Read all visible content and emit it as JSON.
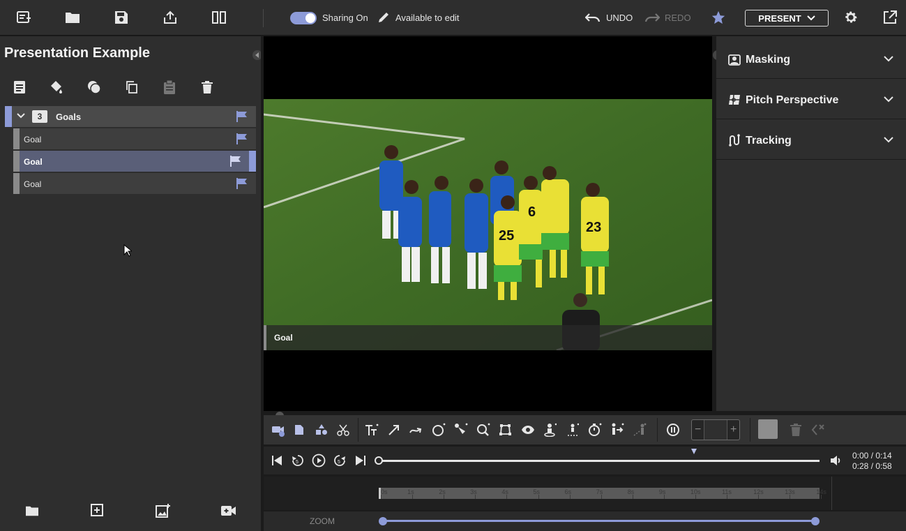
{
  "topbar": {
    "sharing_label": "Sharing On",
    "sharing_on": true,
    "edit_label": "Available to edit",
    "undo_label": "UNDO",
    "redo_label": "REDO",
    "present_label": "PRESENT"
  },
  "left": {
    "title": "Presentation Example",
    "group": {
      "count": "3",
      "label": "Goals"
    },
    "items": [
      {
        "label": "Goal"
      },
      {
        "label": "Goal"
      },
      {
        "label": "Goal"
      }
    ]
  },
  "video": {
    "caption": "Goal"
  },
  "right": {
    "sections": [
      {
        "label": "Masking"
      },
      {
        "label": "Pitch Perspective"
      },
      {
        "label": "Tracking"
      }
    ]
  },
  "playback": {
    "time_current": "0:00 / 0:14",
    "time_total": "0:28 / 0:58"
  },
  "timeline": {
    "ticks": [
      "0s",
      "1s",
      "2s",
      "3s",
      "4s",
      "5s",
      "6s",
      "7s",
      "8s",
      "9s",
      "10s",
      "11s",
      "12s",
      "13s",
      "14s"
    ]
  },
  "zoom": {
    "label": "ZOOM"
  },
  "colors": {
    "accent": "#8d9bd8",
    "pitch": "#3f6b25",
    "home_kit": "#1f5bc0",
    "away_kit": "#e9e035"
  }
}
